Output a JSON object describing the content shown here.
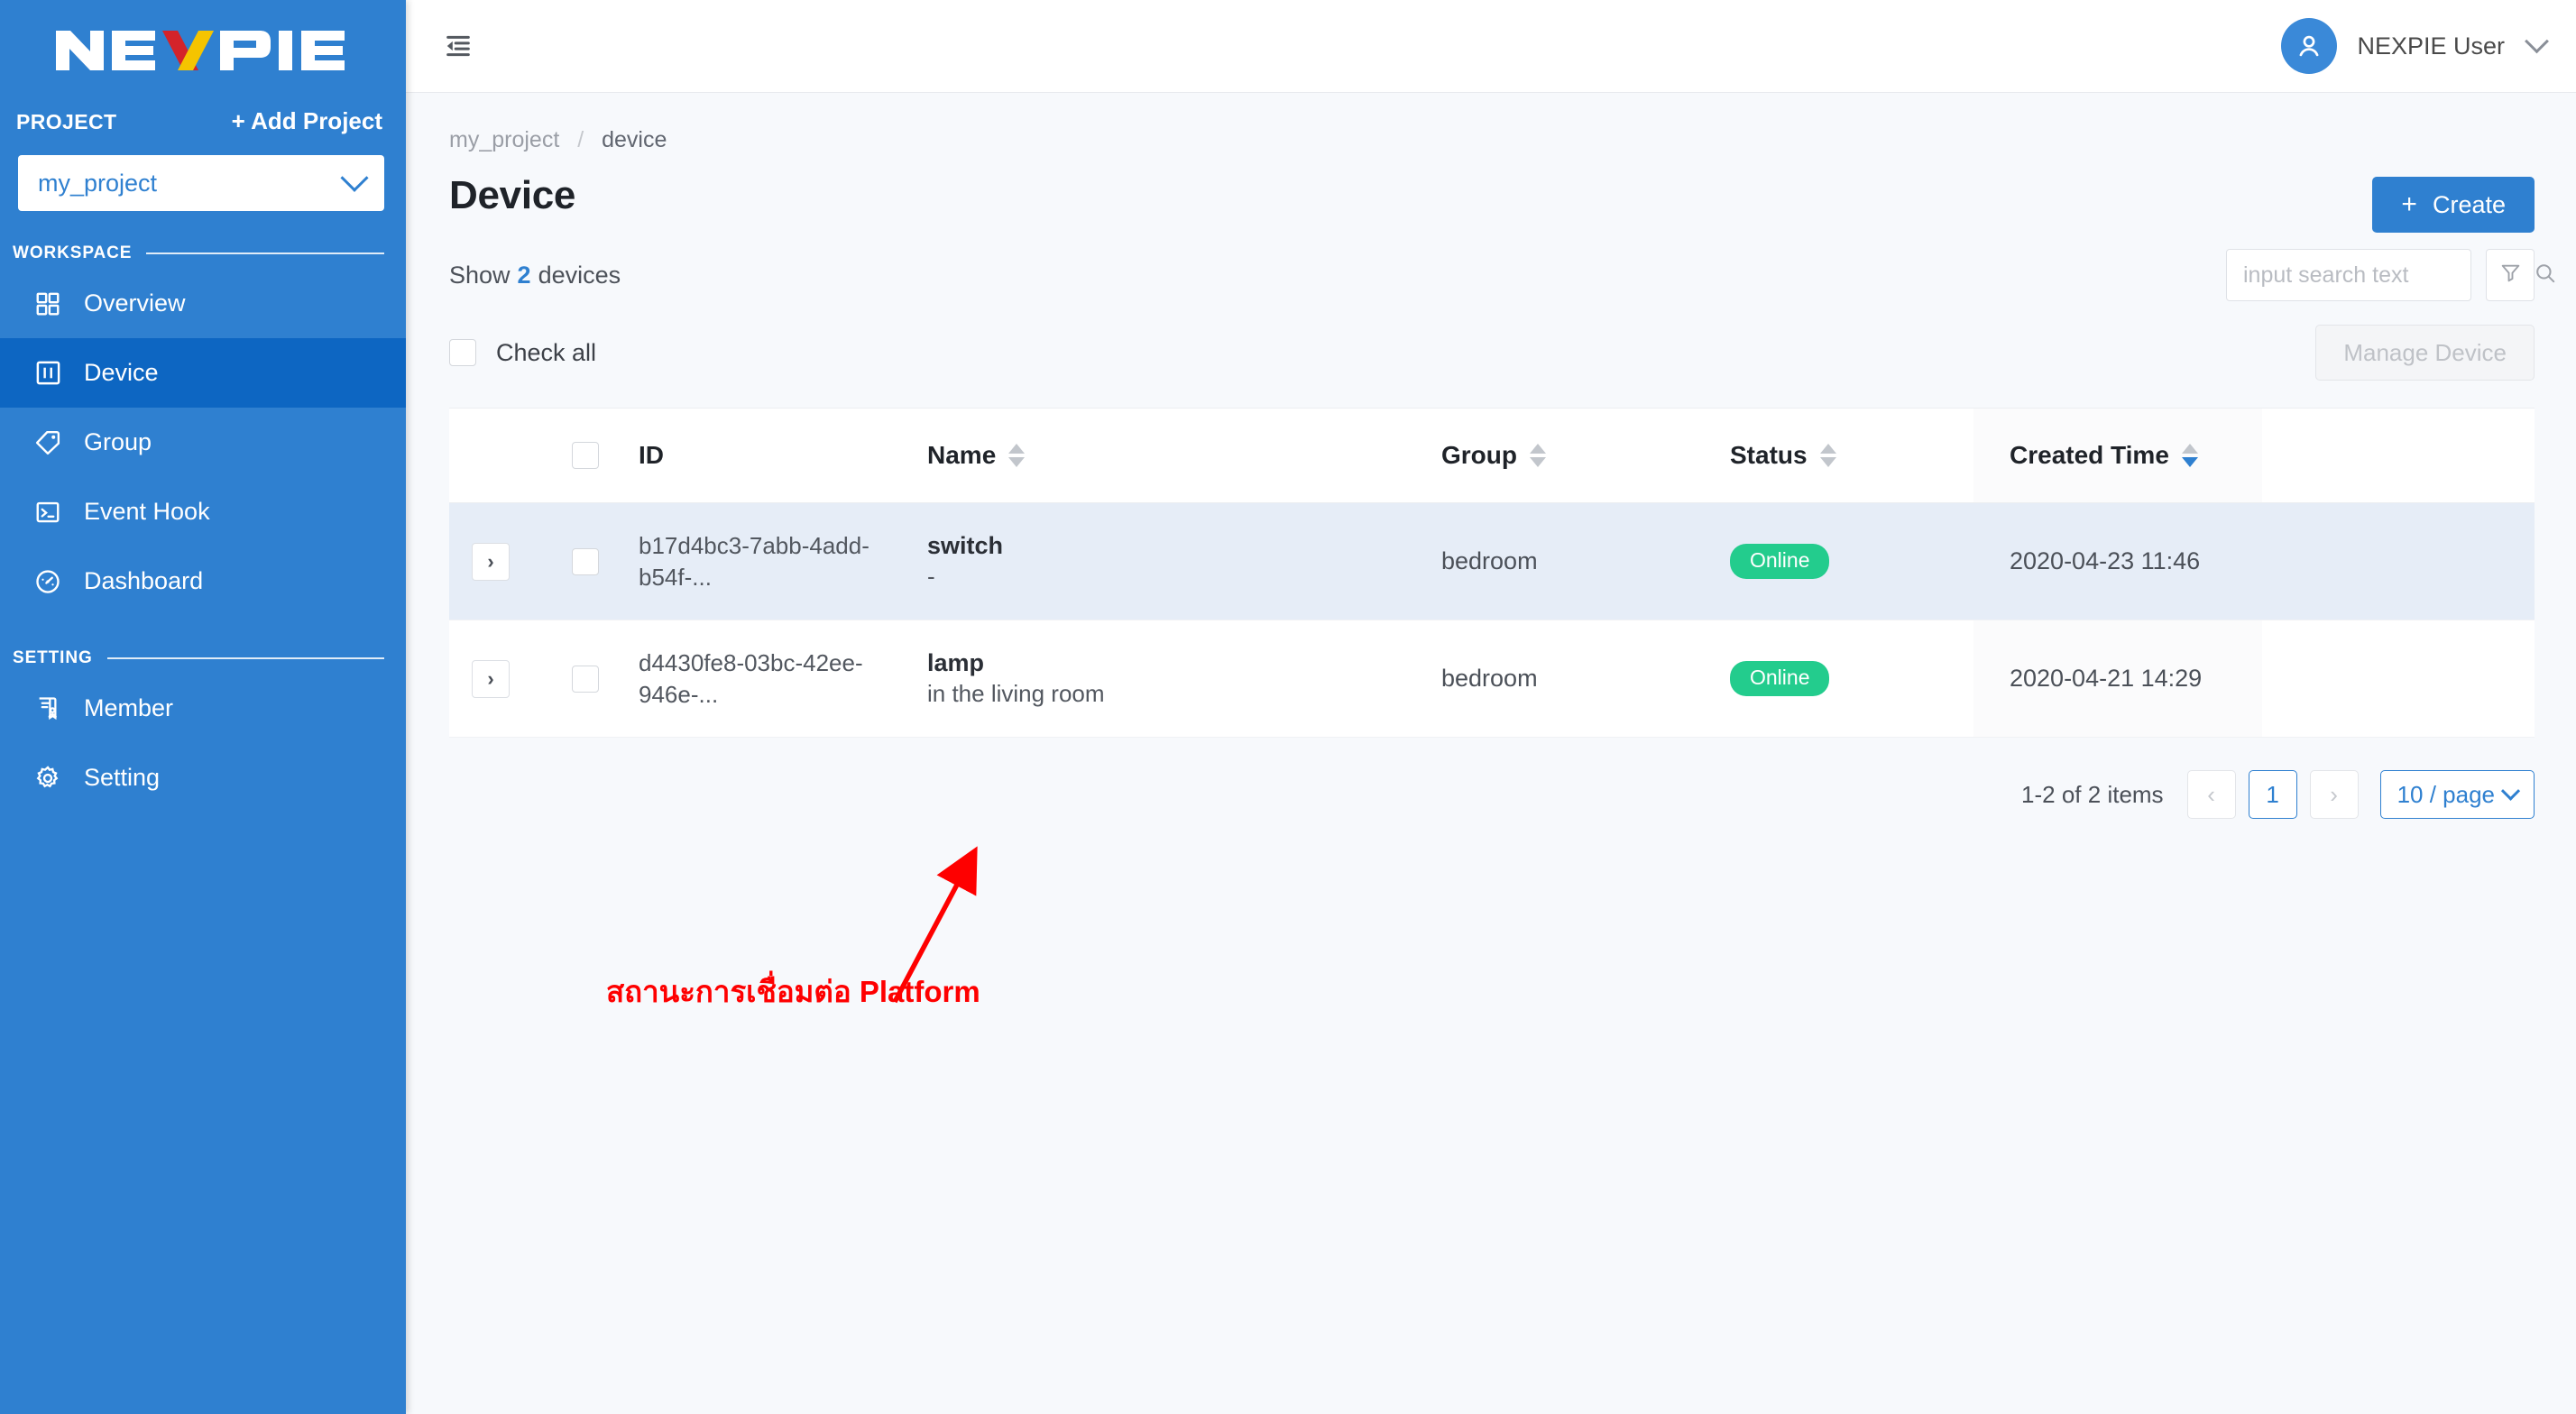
{
  "brand": {
    "name": "NEXPIE",
    "logo_colors": {
      "white": "#ffffff",
      "red": "#d4232a",
      "yellow": "#f5c400"
    }
  },
  "sidebar": {
    "project_label": "PROJECT",
    "add_project_label": "+ Add Project",
    "project_selector": {
      "value": "my_project",
      "icon": "chevron-down-icon"
    },
    "sections": [
      {
        "title": "WORKSPACE",
        "items": [
          {
            "label": "Overview",
            "icon": "grid-icon",
            "active": false
          },
          {
            "label": "Device",
            "icon": "device-icon",
            "active": true
          },
          {
            "label": "Group",
            "icon": "tag-icon",
            "active": false
          },
          {
            "label": "Event Hook",
            "icon": "terminal-icon",
            "active": false
          },
          {
            "label": "Dashboard",
            "icon": "gauge-icon",
            "active": false
          }
        ]
      },
      {
        "title": "SETTING",
        "items": [
          {
            "label": "Member",
            "icon": "member-icon",
            "active": false
          },
          {
            "label": "Setting",
            "icon": "gear-icon",
            "active": false
          }
        ]
      }
    ]
  },
  "topbar": {
    "collapse_icon": "menu-fold-icon",
    "user": {
      "name": "NEXPIE User",
      "avatar_icon": "user-icon",
      "chevron": "chevron-down-icon"
    }
  },
  "breadcrumb": {
    "root": "my_project",
    "separator": "/",
    "current": "device"
  },
  "page": {
    "title": "Device",
    "create_button": {
      "label": "Create",
      "plus": "+"
    },
    "show_prefix": "Show",
    "show_count": "2",
    "show_suffix": "devices",
    "search": {
      "placeholder": "input search text",
      "value": "",
      "icon": "search-icon"
    },
    "filter_icon": "filter-icon",
    "check_all_label": "Check all",
    "manage_button": "Manage Device"
  },
  "table": {
    "columns": [
      {
        "key": "id",
        "label": "ID",
        "sortable": false,
        "sort": "none"
      },
      {
        "key": "name",
        "label": "Name",
        "sortable": true,
        "sort": "none"
      },
      {
        "key": "group",
        "label": "Group",
        "sortable": true,
        "sort": "none"
      },
      {
        "key": "status",
        "label": "Status",
        "sortable": true,
        "sort": "none"
      },
      {
        "key": "created",
        "label": "Created Time",
        "sortable": true,
        "sort": "desc"
      }
    ],
    "rows": [
      {
        "expand_icon": "chevron-right-icon",
        "checked": false,
        "id": "b17d4bc3-7abb-4add-b54f-...",
        "name": "switch",
        "name_sub": "-",
        "group": "bedroom",
        "status": "Online",
        "created": "2020-04-23 11:46",
        "highlighted": true
      },
      {
        "expand_icon": "chevron-right-icon",
        "checked": false,
        "id": "d4430fe8-03bc-42ee-946e-...",
        "name": "lamp",
        "name_sub": "in the living room",
        "group": "bedroom",
        "status": "Online",
        "created": "2020-04-21 14:29",
        "highlighted": false
      }
    ]
  },
  "pagination": {
    "items_text": "1-2 of 2 items",
    "prev_icon": "chevron-left-icon",
    "next_icon": "chevron-right-icon",
    "current_page": "1",
    "page_size": "10 / page"
  },
  "annotation": {
    "text": "สถานะการเชื่อมต่อ Platform",
    "color": "#fe0000",
    "arrow": "red-arrow-up-right"
  },
  "colors": {
    "sidebar_blue": "#2f80d0",
    "sidebar_active": "#0d66c2",
    "accent": "#2f80d0",
    "status_online": "#23cc8d",
    "row_highlight": "#e6edf7",
    "page_bg": "#f7f9fc"
  }
}
